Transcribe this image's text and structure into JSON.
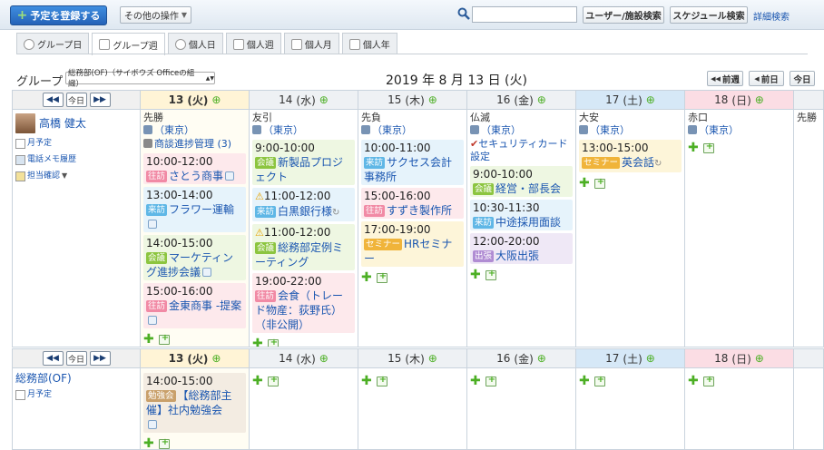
{
  "toolbar": {
    "register_label": "予定を登録する",
    "other_label": "その他の操作",
    "user_search_label": "ユーザー/施設検索",
    "schedule_search_label": "スケジュール検索",
    "detail_search_label": "詳細検索",
    "search_value": ""
  },
  "tabs": [
    "グループ日",
    "グループ週",
    "個人日",
    "個人週",
    "個人月",
    "個人年"
  ],
  "group": {
    "label": "グループ",
    "selected": "総務部(OF)（サイボウズ Officeの組織）"
  },
  "date_title": "2019 年 8 月 13 日 (火)",
  "nav": {
    "prev_week": "前週",
    "prev_day": "前日",
    "today": "今日"
  },
  "header_nav": {
    "today": "今日"
  },
  "days": [
    {
      "date": "13",
      "dow": "(火)",
      "type": "today"
    },
    {
      "date": "14",
      "dow": "(水)",
      "type": "normal"
    },
    {
      "date": "15",
      "dow": "(木)",
      "type": "normal"
    },
    {
      "date": "16",
      "dow": "(金)",
      "type": "normal"
    },
    {
      "date": "17",
      "dow": "(土)",
      "type": "sat"
    },
    {
      "date": "18",
      "dow": "(日)",
      "type": "sun"
    },
    {
      "date": "",
      "dow": "",
      "type": "normal"
    }
  ],
  "row1": {
    "person": "高橋 健太",
    "links": [
      "月予定",
      "電話メモ履歴",
      "担当確認"
    ],
    "cells": [
      {
        "rokuyo": "先勝",
        "fac": "（東京）",
        "extra": "商談進捗管理 (3)",
        "events": [
          {
            "time": "10:00-12:00",
            "badge": "往訪",
            "title": "さとう商事",
            "c": "c1",
            "b": "b-pink"
          },
          {
            "time": "13:00-14:00",
            "badge": "来訪",
            "title": "フラワー運輸",
            "c": "c2",
            "b": "b-blue"
          },
          {
            "time": "14:00-15:00",
            "badge": "会議",
            "title": "マーケティング進捗会議",
            "c": "c3",
            "b": "b-green"
          },
          {
            "time": "15:00-16:00",
            "badge": "往訪",
            "title": "金東商事 -提案",
            "c": "c1",
            "b": "b-pink"
          }
        ]
      },
      {
        "rokuyo": "友引",
        "fac": "（東京）",
        "events": [
          {
            "time": "9:00-10:00",
            "badge": "会議",
            "title": "新製品プロジェクト",
            "c": "c3",
            "b": "b-green"
          },
          {
            "time": "11:00-12:00",
            "badge": "来訪",
            "title": "白黒銀行様",
            "c": "c2",
            "b": "b-blue",
            "warn": true
          },
          {
            "time": "11:00-12:00",
            "badge": "会議",
            "title": "総務部定例ミーティング",
            "c": "c3",
            "b": "b-green",
            "warn": true
          },
          {
            "time": "19:00-22:00",
            "badge": "往訪",
            "title": "会食（トレード物産：荻野氏）（非公開）",
            "c": "c1",
            "b": "b-pink"
          }
        ]
      },
      {
        "rokuyo": "先負",
        "fac": "（東京）",
        "events": [
          {
            "time": "10:00-11:00",
            "badge": "来訪",
            "title": "サクセス会計事務所",
            "c": "c2",
            "b": "b-blue"
          },
          {
            "time": "15:00-16:00",
            "badge": "往訪",
            "title": "すずき製作所",
            "c": "c1",
            "b": "b-pink"
          },
          {
            "time": "17:00-19:00",
            "badge": "セミナー",
            "title": "HRセミナー",
            "c": "c4",
            "b": "b-orange"
          }
        ]
      },
      {
        "rokuyo": "仏滅",
        "fac": "（東京）",
        "extra": "セキュリティカード設定",
        "events": [
          {
            "time": "9:00-10:00",
            "badge": "会議",
            "title": "経営・部長会",
            "c": "c3",
            "b": "b-green"
          },
          {
            "time": "10:30-11:30",
            "badge": "来訪",
            "title": "中途採用面談",
            "c": "c2",
            "b": "b-blue"
          },
          {
            "time": "12:00-20:00",
            "badge": "出張",
            "title": "大阪出張",
            "c": "c5",
            "b": "b-purple"
          }
        ]
      },
      {
        "rokuyo": "大安",
        "fac": "（東京）",
        "events": [
          {
            "time": "13:00-15:00",
            "badge": "セミナー",
            "title": "英会話",
            "c": "c4",
            "b": "b-orange"
          }
        ]
      },
      {
        "rokuyo": "赤口",
        "fac": "（東京）",
        "events": []
      },
      {
        "rokuyo": "先勝",
        "fac": "",
        "events": []
      }
    ]
  },
  "row2": {
    "group": "総務部(OF)",
    "links": [
      "月予定"
    ],
    "event": {
      "time": "14:00-15:00",
      "badge": "勉強会",
      "title": "【総務部主催】社内勉強会",
      "c": "c6",
      "b": "b-brown"
    }
  }
}
